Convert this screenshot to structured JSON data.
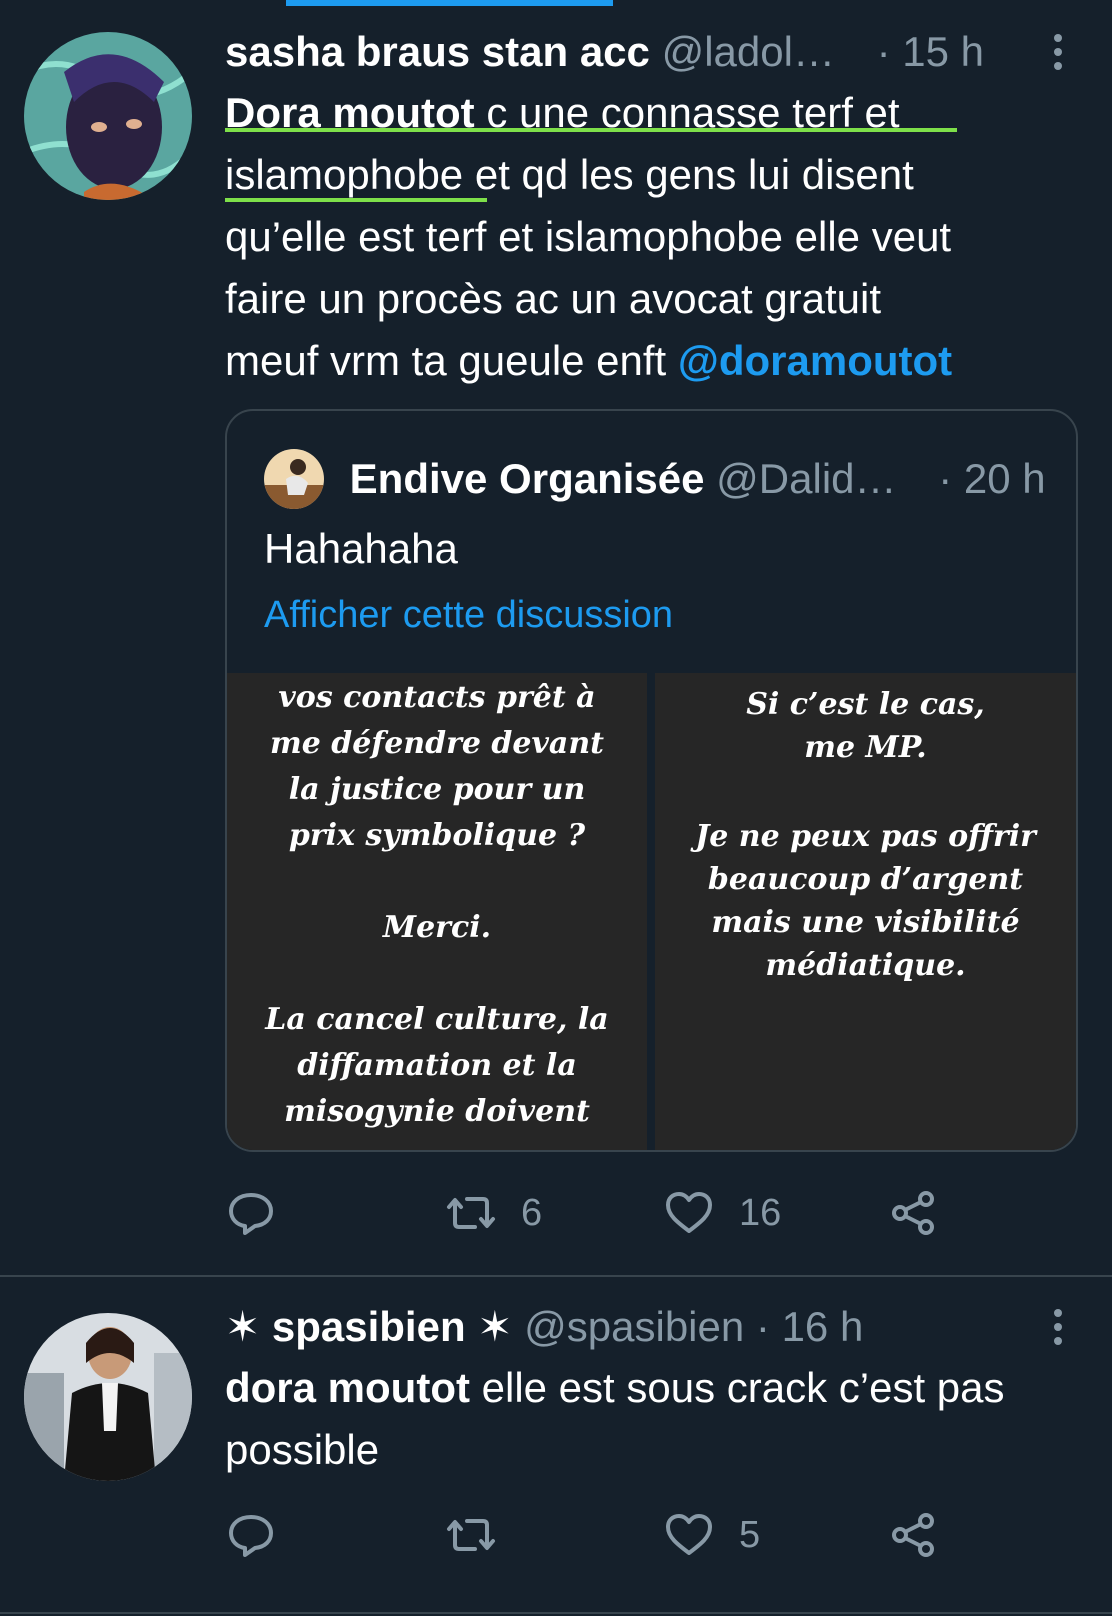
{
  "tweets": [
    {
      "display_name": "sasha braus stan acc",
      "handle": "@ladol…",
      "separator": "·",
      "time": "15 h",
      "text": {
        "part1_bold": "Dora moutot",
        "part2": " c une connasse terf et",
        "part3": "islamophobe",
        "part4": " et qd les gens lui disent",
        "line3": "qu’elle est terf et islamophobe elle veut",
        "line4": "faire un procès ac un avocat gratuit",
        "line5": "meuf vrm ta gueule enft ",
        "mention": "@doramoutot"
      },
      "quote": {
        "display_name": "Endive Organisée",
        "handle": "@Dalid…",
        "separator": "·",
        "time": "20 h",
        "text": "Hahahaha",
        "show_thread": "Afficher cette discussion",
        "media_left_lines": [
          "vos contacts prêt à",
          "me défendre devant",
          "la justice pour un",
          "prix symbolique ?",
          "",
          "Merci.",
          "",
          "La cancel culture, la",
          "diffamation  et la",
          "misogynie doivent"
        ],
        "media_right_lines": [
          "Si c’est le cas,",
          "me MP.",
          "",
          "Je ne peux pas offrir",
          "beaucoup d’argent",
          "mais une visibilité",
          "médiatique."
        ]
      },
      "actions": {
        "replies": "",
        "retweets": "6",
        "likes": "16"
      }
    },
    {
      "display_name": "✶ spasibien ✶",
      "handle": "@spasibien",
      "separator": "·",
      "time": "16 h",
      "text": {
        "bold": "dora moutot",
        "rest_line1": " elle est sous crack c’est pas",
        "line2": "possible"
      },
      "actions": {
        "replies": "",
        "retweets": "",
        "likes": "5"
      }
    }
  ],
  "colors": {
    "background": "#15202b",
    "accent": "#1d9bf0",
    "secondary": "#8899a6",
    "highlight_underline": "#7ee04a"
  },
  "icons": [
    "reply-icon",
    "retweet-icon",
    "like-icon",
    "share-icon",
    "more-options-icon"
  ]
}
